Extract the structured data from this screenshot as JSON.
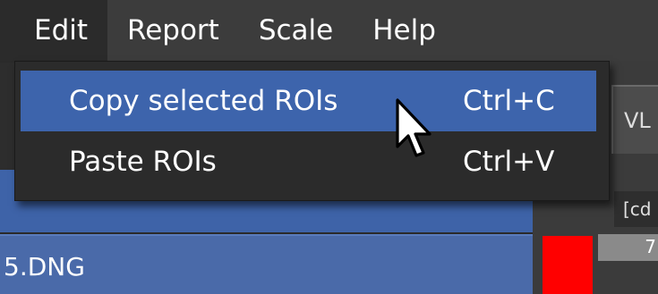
{
  "menubar": {
    "items": [
      {
        "label": "Edit",
        "active": true
      },
      {
        "label": "Report",
        "active": false
      },
      {
        "label": "Scale",
        "active": false
      },
      {
        "label": "Help",
        "active": false
      }
    ]
  },
  "edit_menu": {
    "items": [
      {
        "label": "Copy selected ROIs",
        "shortcut": "Ctrl+C",
        "highlighted": true
      },
      {
        "label": "Paste ROIs",
        "shortcut": "Ctrl+V",
        "highlighted": false
      }
    ]
  },
  "background": {
    "file_label": "5.DNG",
    "right_tab_label": "VL",
    "right_header_label": "[cd",
    "right_value": "7",
    "swatch_color": "#ff0000"
  },
  "colors": {
    "highlight": "#3d64ac",
    "menu_bg": "#2b2b2b",
    "menubar_bg": "#3c3c3c"
  }
}
